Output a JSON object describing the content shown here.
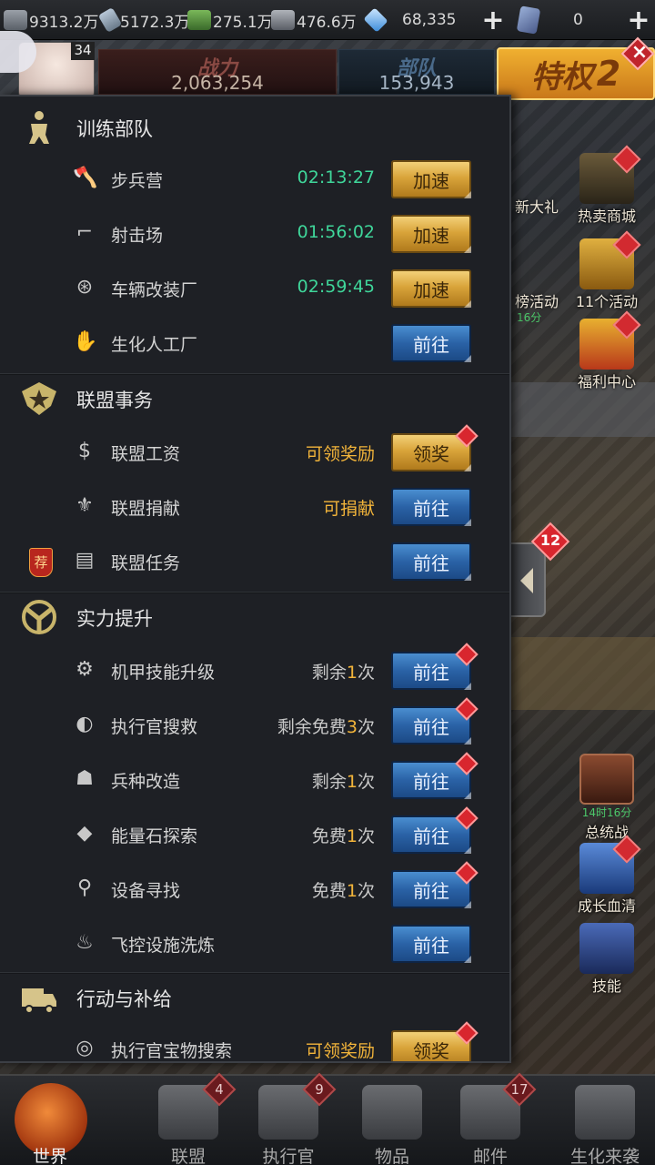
{
  "topbar": {
    "resources": [
      {
        "icon": "oil-barrel-icon",
        "value": "9313.2万",
        "color": "#7a8088"
      },
      {
        "icon": "ammo-icon",
        "value": "5172.3万",
        "color": "#8a9aaa"
      },
      {
        "icon": "cash-icon",
        "value": "275.1万",
        "color": "#4a8a3a"
      },
      {
        "icon": "metal-icon",
        "value": "476.6万",
        "color": "#8a8e96"
      },
      {
        "icon": "diamond-icon",
        "value": "68,335",
        "color": "#5aa0e0"
      }
    ],
    "second_currency": "0",
    "plus": "+"
  },
  "header": {
    "avatar_level": "34",
    "power_label": "战力",
    "power_value": "2,063,254",
    "troops_label": "部队",
    "troops_value": "153,943",
    "privilege_label": "特权",
    "privilege_level": "2"
  },
  "right_activities": [
    {
      "label": "热卖商城",
      "sub": ""
    },
    {
      "label": "11个活动",
      "sub": ""
    },
    {
      "label": "福利中心",
      "sub": ""
    },
    {
      "label": "总统战",
      "sub": "14时16分"
    },
    {
      "label": "成长血清",
      "sub": ""
    },
    {
      "label": "技能",
      "sub": ""
    }
  ],
  "partial_labels": {
    "gift": "新大礼",
    "event": "榜活动",
    "event_sub": "16分"
  },
  "side_tab": {
    "badge": "12"
  },
  "panel": {
    "sections": [
      {
        "title": "训练部队",
        "icon": "soldier-icon",
        "rows": [
          {
            "icon": "axe-icon",
            "label": "步兵营",
            "status": "02:13:27",
            "status_type": "timer",
            "button": "加速",
            "button_type": "gold",
            "dot": false
          },
          {
            "icon": "pistol-icon",
            "label": "射击场",
            "status": "01:56:02",
            "status_type": "timer",
            "button": "加速",
            "button_type": "gold",
            "dot": false
          },
          {
            "icon": "wheel-icon",
            "label": "车辆改装厂",
            "status": "02:59:45",
            "status_type": "timer",
            "button": "加速",
            "button_type": "gold",
            "dot": false
          },
          {
            "icon": "biohand-icon",
            "label": "生化人工厂",
            "status": "",
            "status_type": "none",
            "button": "前往",
            "button_type": "blue",
            "dot": false
          }
        ]
      },
      {
        "title": "联盟事务",
        "icon": "alliance-emblem-icon",
        "rows": [
          {
            "icon": "money-icon",
            "label": "联盟工资",
            "status": "可领奖励",
            "status_type": "gold",
            "button": "领奖",
            "button_type": "gold",
            "dot": true
          },
          {
            "icon": "donate-icon",
            "label": "联盟捐献",
            "status": "可捐献",
            "status_type": "gold",
            "button": "前往",
            "button_type": "blue",
            "dot": false
          },
          {
            "icon": "clipboard-icon",
            "label": "联盟任务",
            "status": "",
            "status_type": "none",
            "button": "前往",
            "button_type": "blue",
            "dot": false,
            "tag": "荐"
          }
        ]
      },
      {
        "title": "实力提升",
        "icon": "power-emblem-icon",
        "rows": [
          {
            "icon": "mech-icon",
            "label": "机甲技能升级",
            "status_pre": "剩余",
            "status_num": "1",
            "status_post": "次",
            "status_type": "count",
            "button": "前往",
            "button_type": "blue",
            "dot": true
          },
          {
            "icon": "radar-icon",
            "label": "执行官搜救",
            "status_pre": "剩余免费",
            "status_num": "3",
            "status_post": "次",
            "status_type": "count",
            "button": "前往",
            "button_type": "blue",
            "dot": true
          },
          {
            "icon": "rock-icon",
            "label": "兵种改造",
            "status_pre": "剩余",
            "status_num": "1",
            "status_post": "次",
            "status_type": "count",
            "button": "前往",
            "button_type": "blue",
            "dot": true
          },
          {
            "icon": "crystal-icon",
            "label": "能量石探索",
            "status_pre": "免费",
            "status_num": "1",
            "status_post": "次",
            "status_type": "count",
            "button": "前往",
            "button_type": "blue",
            "dot": true
          },
          {
            "icon": "key-icon",
            "label": "设备寻找",
            "status_pre": "免费",
            "status_num": "1",
            "status_post": "次",
            "status_type": "count",
            "button": "前往",
            "button_type": "blue",
            "dot": true
          },
          {
            "icon": "satellite-icon",
            "label": "飞控设施洗炼",
            "status": "",
            "status_type": "none",
            "button": "前往",
            "button_type": "blue",
            "dot": false
          }
        ]
      },
      {
        "title": "行动与补给",
        "icon": "truck-icon",
        "rows": [
          {
            "icon": "search-icon",
            "label": "执行官宝物搜索",
            "status": "可领奖励",
            "status_type": "gold",
            "button": "领奖",
            "button_type": "gold",
            "dot": true
          }
        ]
      }
    ]
  },
  "bottomnav": [
    {
      "label": "世界",
      "badge": ""
    },
    {
      "label": "联盟",
      "badge": "4"
    },
    {
      "label": "执行官",
      "badge": "9"
    },
    {
      "label": "物品",
      "badge": ""
    },
    {
      "label": "邮件",
      "badge": "17"
    },
    {
      "label": "生化来袭",
      "badge": ""
    }
  ]
}
